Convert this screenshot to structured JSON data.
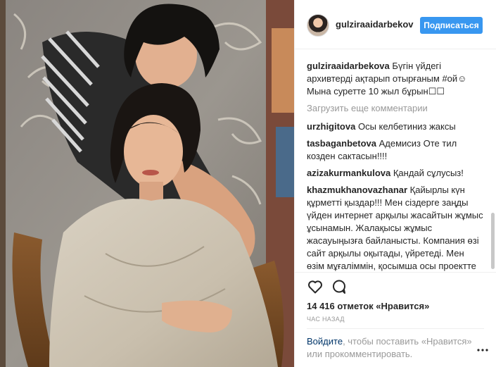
{
  "post": {
    "username": "gulziraaidarbekov",
    "follow_label": "Подписаться",
    "caption": {
      "user": "gulziraaidarbekova",
      "text": "Бүгін үйдегі архивтерді ақтарып отырғаным #ой☺ Мына суретте 10 жыл бұрын☐☐"
    },
    "load_more": "Загрузить еще комментарии",
    "comments": [
      {
        "user": "urzhigitova",
        "text": "Осы келбетиниз жаксы"
      },
      {
        "user": "tasbaganbetova",
        "text": "Адемисиз Оте тил козден сактасын!!!!"
      },
      {
        "user": "azizakurmankulova",
        "text": "Қандай сұлусыз!"
      },
      {
        "user": "khazmukhanovazhanar",
        "text": "Қайырлы күн құрметті қыздар!!! Мен сіздерге заңды үйден интернет арқылы жасайтын жұмыс ұсынамын. Жалақысы жұмыс жасауыңызға байланысты. Компания өзі сайт арқылы оқытады, үйретеді. Мен өзім мұғаліммін, қосымша осы проектте жұмыс жасаймын. Егер сізді бұл ұсыныс қызықтырса директке жазыңыз немесе парақшама комментарий қалдырыңыз."
      }
    ],
    "likes": "14 416 отметок «Нравится»",
    "time": "ЧАС НАЗАД",
    "login_prompt": {
      "link": "Войдите",
      "rest": ", чтобы поставить «Нравится» или прокомментировать."
    }
  },
  "icons": {
    "like": "heart-outline-icon",
    "comment": "speech-bubble-icon",
    "more": "ellipsis-icon"
  },
  "colors": {
    "follow_button": "#3897f0",
    "muted_text": "#999999",
    "link": "#003569"
  }
}
